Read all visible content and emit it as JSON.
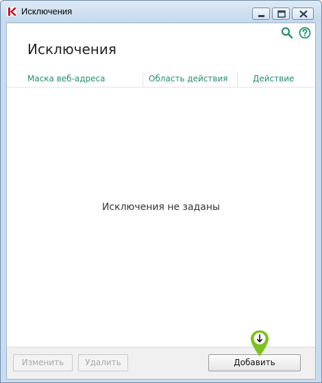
{
  "window": {
    "title": "Исключения",
    "brand_color": "#d0021b"
  },
  "toolbar": {
    "search_icon": "search-icon",
    "help_icon": "help-icon",
    "accent_color": "#1f8f6c"
  },
  "page": {
    "title": "Исключения"
  },
  "table": {
    "columns": [
      "Маска веб-адреса",
      "Область действия",
      "Действие"
    ],
    "empty_message": "Исключения не заданы"
  },
  "buttons": {
    "edit": "Изменить",
    "delete": "Удалить",
    "add": "Добавить"
  }
}
